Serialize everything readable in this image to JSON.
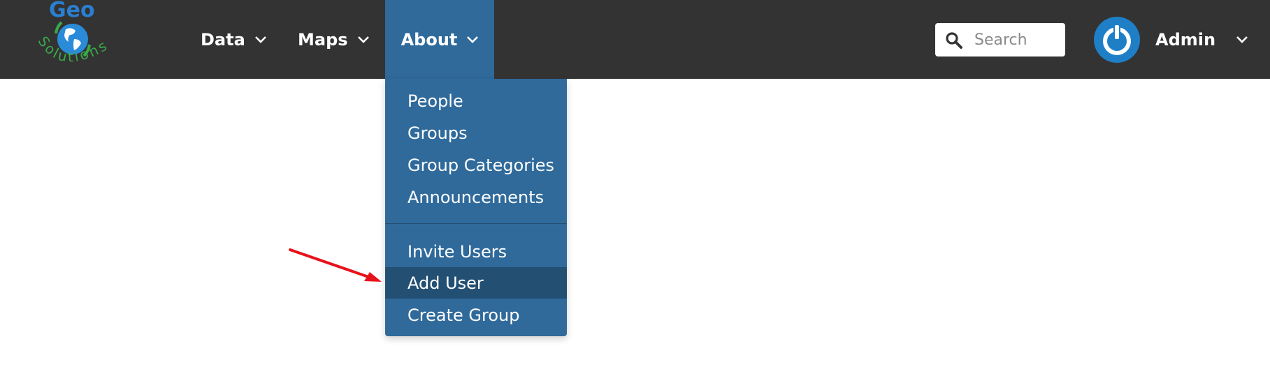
{
  "logo": {
    "text_top": "Geo",
    "text_arc": "Solutions"
  },
  "nav": {
    "items": [
      {
        "label": "Data"
      },
      {
        "label": "Maps"
      },
      {
        "label": "About"
      }
    ]
  },
  "search": {
    "placeholder": "Search",
    "value": ""
  },
  "user": {
    "label": "Admin"
  },
  "about_menu": {
    "items": [
      {
        "label": "People"
      },
      {
        "label": "Groups"
      },
      {
        "label": "Group Categories"
      },
      {
        "label": "Announcements"
      },
      {
        "label": "Invite Users"
      },
      {
        "label": "Add User"
      },
      {
        "label": "Create Group"
      }
    ],
    "highlighted": "Add User"
  },
  "colors": {
    "navbar": "#333333",
    "active_menu": "#2f6a9b",
    "hover_item": "#234f73",
    "annotation_arrow": "#e8121b"
  },
  "icons": {
    "search": "magnifier-icon",
    "avatar": "power-icon",
    "chevron": "chevron-down-icon",
    "logo": "globe-icon"
  }
}
